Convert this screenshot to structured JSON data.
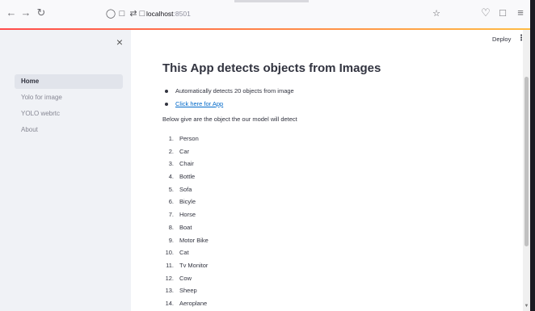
{
  "browser": {
    "back_icon": "arrow-left-icon",
    "forward_icon": "arrow-right-icon",
    "reload_icon": "reload-icon",
    "url_host": "localhost",
    "url_port": ":8501",
    "bookmark_icon": "star-icon",
    "pocket_icon": "pocket-icon",
    "extensions_icon": "puzzle-icon",
    "menu_icon": "hamburger-icon"
  },
  "sidebar": {
    "close_label": "×",
    "items": [
      {
        "label": "Home",
        "active": true
      },
      {
        "label": "Yolo for image",
        "active": false
      },
      {
        "label": "YOLO webrtc",
        "active": false
      },
      {
        "label": "About",
        "active": false
      }
    ]
  },
  "header": {
    "deploy_label": "Deploy",
    "menu_label": "⋮"
  },
  "main": {
    "title": "This App detects objects from Images",
    "bullets": [
      "Automatically detects 20 objects from image",
      "Click here for App"
    ],
    "intro": "Below give are the object the our model will detect",
    "objects": [
      "Person",
      "Car",
      "Chair",
      "Bottle",
      "Sofa",
      "Bicyle",
      "Horse",
      "Boat",
      "Motor Bike",
      "Cat",
      "Tv Monitor",
      "Cow",
      "Sheep",
      "Aeroplane"
    ]
  },
  "colors": {
    "accent": "#ff4b4b",
    "link": "#0068c9",
    "sidebar_bg": "#f0f2f6",
    "text": "#31333f"
  }
}
